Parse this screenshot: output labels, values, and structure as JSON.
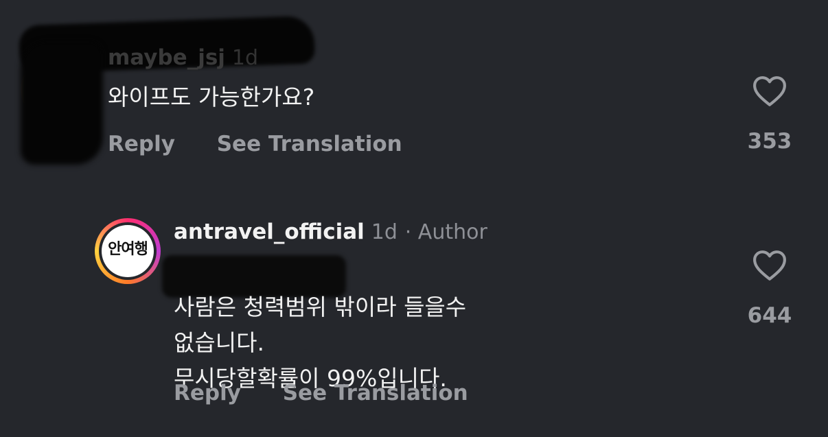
{
  "comments": [
    {
      "username": "maybe_jsj",
      "time": "1d",
      "text": "와이프도 가능한가요?",
      "reply_label": "Reply",
      "translate_label": "See Translation",
      "likes": "353"
    },
    {
      "username": "antravel_official",
      "time": "1d",
      "author_badge": "· Author",
      "avatar_text": "안여행",
      "text": "사람은 청력범위 밖이라 들을수\n없습니다.\n무시당할확률이 99%입니다.",
      "reply_label": "Reply",
      "translate_label": "See Translation",
      "likes": "644"
    }
  ],
  "colors": {
    "background": "#25272c",
    "text": "#f2f2f2",
    "muted": "#9a9ca1",
    "story_ring": "#ff2d6f"
  },
  "icons": {
    "like": "heart-outline-icon"
  }
}
